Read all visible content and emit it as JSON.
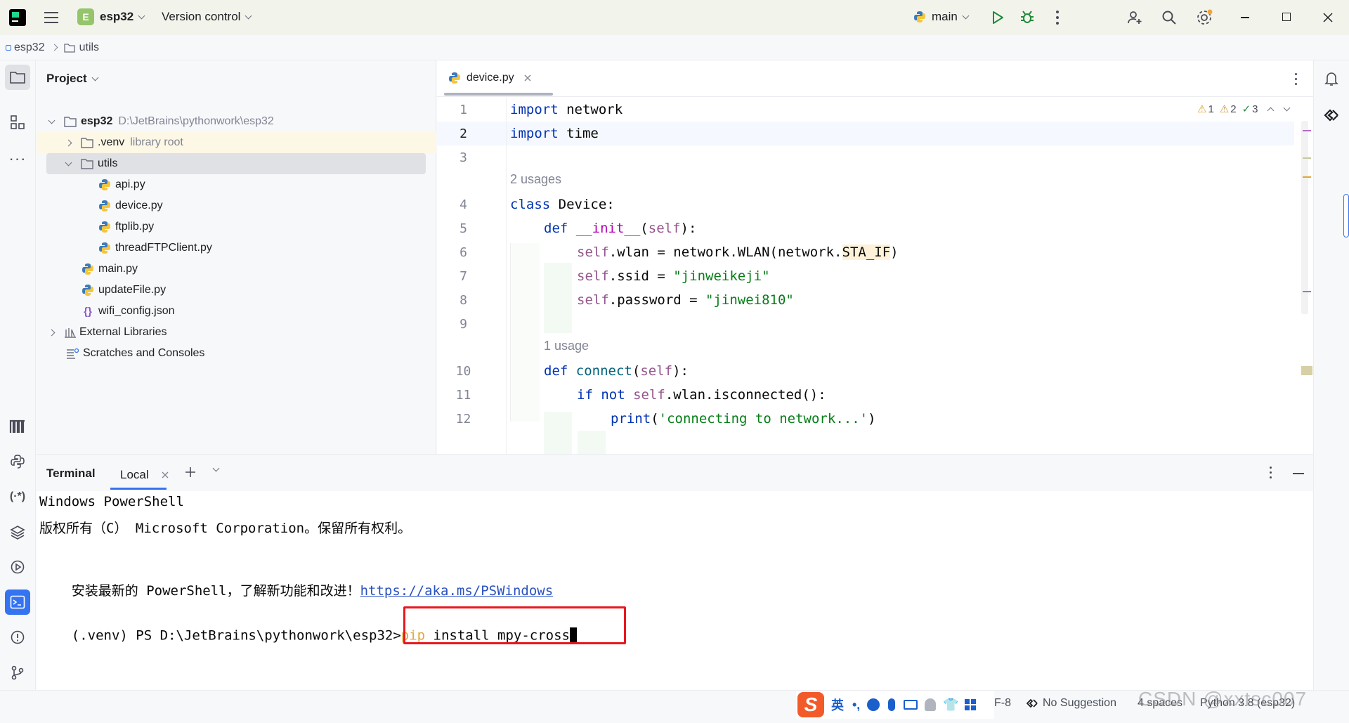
{
  "titlebar": {
    "project_badge": "E",
    "project_name": "esp32",
    "vcs": "Version control",
    "branch": "main"
  },
  "breadcrumb": [
    "esp32",
    "utils"
  ],
  "project_panel": {
    "title": "Project",
    "tree": [
      {
        "name": "esp32",
        "detail": "D:\\JetBrains\\pythonwork\\esp32",
        "kind": "folder",
        "depth": 0,
        "expanded": true
      },
      {
        "name": ".venv",
        "detail": "library root",
        "kind": "folder",
        "depth": 1,
        "expanded": false
      },
      {
        "name": "utils",
        "detail": "",
        "kind": "folder",
        "depth": 1,
        "expanded": true
      },
      {
        "name": "api.py",
        "detail": "",
        "kind": "py",
        "depth": 2
      },
      {
        "name": "device.py",
        "detail": "",
        "kind": "py",
        "depth": 2
      },
      {
        "name": "ftplib.py",
        "detail": "",
        "kind": "py",
        "depth": 2
      },
      {
        "name": "threadFTPClient.py",
        "detail": "",
        "kind": "py",
        "depth": 2
      },
      {
        "name": "main.py",
        "detail": "",
        "kind": "py",
        "depth": 1
      },
      {
        "name": "updateFile.py",
        "detail": "",
        "kind": "py",
        "depth": 1
      },
      {
        "name": "wifi_config.json",
        "detail": "",
        "kind": "json",
        "depth": 1
      },
      {
        "name": "External Libraries",
        "detail": "",
        "kind": "lib",
        "depth": 0
      },
      {
        "name": "Scratches and Consoles",
        "detail": "",
        "kind": "scratch",
        "depth": 0
      }
    ]
  },
  "editor": {
    "tab": "device.py",
    "inspections": {
      "warn_a": "1",
      "warn_b": "2",
      "ok": "3"
    },
    "hint_2_usages": "2 usages",
    "hint_1_usage": "1 usage",
    "line_numbers": [
      "1",
      "2",
      "3",
      "4",
      "5",
      "6",
      "7",
      "8",
      "9",
      "10",
      "11",
      "12"
    ],
    "lines": {
      "l1": {
        "kw": "import",
        "rest": " network"
      },
      "l2": {
        "kw": "import",
        "rest": " time"
      },
      "l4": {
        "kw": "class",
        "rest": " Device:"
      },
      "l5": {
        "kw": "def",
        "name": "__init__",
        "p1": "(",
        "self": "self",
        "p2": "):"
      },
      "l6": {
        "self": "self",
        "a": ".wlan = network.WLAN(network.",
        "b": "STA_IF",
        "c": ")"
      },
      "l7": {
        "self": "self",
        "a": ".ssid = ",
        "str": "\"jinweikeji\""
      },
      "l8": {
        "self": "self",
        "a": ".password = ",
        "str": "\"jinwei810\""
      },
      "l10": {
        "kw": "def",
        "name": "connect",
        "p1": "(",
        "self": "self",
        "p2": "):"
      },
      "l11": {
        "kw": "if not",
        "self": "self",
        "a": ".wlan.isconnected():"
      },
      "l12": {
        "name": "print",
        "p1": "(",
        "str": "'connecting to network...'",
        "p2": ")"
      }
    }
  },
  "terminal": {
    "title": "Terminal",
    "tab": "Local",
    "line1": "Windows PowerShell",
    "line2": "版权所有（C） Microsoft Corporation。保留所有权利。",
    "line3_text": "安装最新的 PowerShell，了解新功能和改进！",
    "line3_link": "https://aka.ms/PSWindows",
    "prompt": "(.venv) PS D:\\JetBrains\\pythonwork\\esp32>",
    "cmd_pip": "pip",
    "cmd_rest": " install mpy-cross"
  },
  "statusbar": {
    "encoding": "F-8",
    "suggestion": "No Suggestion",
    "indent": "4 spaces",
    "interpreter": "Python 3.8 (esp32)",
    "ime_label": "英",
    "watermark": "CSDN @xxtsc007"
  },
  "colors": {
    "accent": "#3574f0",
    "highlight_box": "#e8171f",
    "keyword": "#0033b3",
    "string": "#067d17"
  }
}
